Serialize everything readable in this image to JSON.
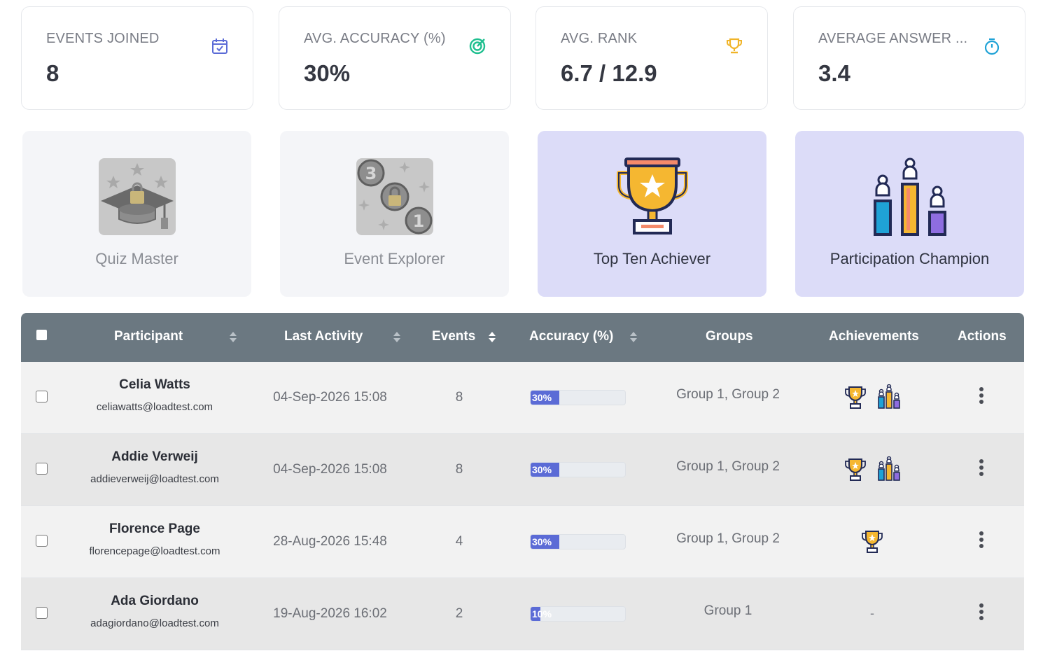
{
  "stats": [
    {
      "label": "EVENTS JOINED",
      "value": "8",
      "icon": "calendar-check-icon",
      "icon_color": "#5b6bd6"
    },
    {
      "label": "AVG. ACCURACY (%)",
      "value": "30%",
      "icon": "target-icon",
      "icon_color": "#1fbf8f"
    },
    {
      "label": "AVG. RANK",
      "value": "6.7 / 12.9",
      "icon": "trophy-icon",
      "icon_color": "#f0b429"
    },
    {
      "label": "AVERAGE ANSWER ...",
      "value": "3.4",
      "icon": "stopwatch-icon",
      "icon_color": "#1fa2d6"
    }
  ],
  "achievements": [
    {
      "label": "Quiz Master",
      "earned": false,
      "icon": "graduation-cap-locked-icon"
    },
    {
      "label": "Event Explorer",
      "earned": false,
      "icon": "coins-locked-icon"
    },
    {
      "label": "Top Ten Achiever",
      "earned": true,
      "icon": "trophy-star-icon"
    },
    {
      "label": "Participation Champion",
      "earned": true,
      "icon": "podium-people-icon"
    }
  ],
  "table": {
    "headers": {
      "participant": "Participant",
      "last_activity": "Last Activity",
      "events": "Events",
      "accuracy": "Accuracy (%)",
      "groups": "Groups",
      "achievements": "Achievements",
      "actions": "Actions"
    },
    "colors": {
      "header_bg": "#6b7881",
      "accuracy_bar": "#5b6bd6"
    },
    "rows": [
      {
        "name": "Celia Watts",
        "email": "celiawatts@loadtest.com",
        "last_activity": "04-Sep-2026 15:08",
        "events": "8",
        "accuracy": 30,
        "accuracy_label": "30%",
        "groups": "Group 1, Group 2",
        "achievements": [
          "trophy-icon",
          "podium-icon"
        ]
      },
      {
        "name": "Addie Verweij",
        "email": "addieverweij@loadtest.com",
        "last_activity": "04-Sep-2026 15:08",
        "events": "8",
        "accuracy": 30,
        "accuracy_label": "30%",
        "groups": "Group 1, Group 2",
        "achievements": [
          "trophy-icon",
          "podium-icon"
        ]
      },
      {
        "name": "Florence Page",
        "email": "florencepage@loadtest.com",
        "last_activity": "28-Aug-2026 15:48",
        "events": "4",
        "accuracy": 30,
        "accuracy_label": "30%",
        "groups": "Group 1, Group 2",
        "achievements": [
          "trophy-icon"
        ]
      },
      {
        "name": "Ada Giordano",
        "email": "adagiordano@loadtest.com",
        "last_activity": "19-Aug-2026 16:02",
        "events": "2",
        "accuracy": 10,
        "accuracy_label": "10%",
        "groups": "Group 1",
        "achievements": [],
        "achievements_empty": "-"
      }
    ]
  }
}
